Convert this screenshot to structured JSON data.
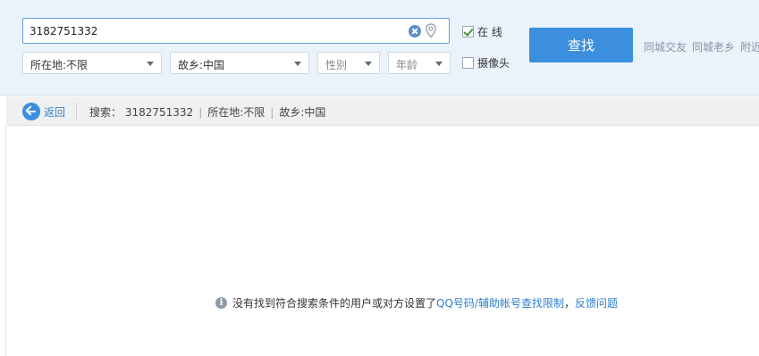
{
  "search": {
    "value": "3182751332",
    "placeholder": ""
  },
  "filters": {
    "location": "所在地:不限",
    "hometown": "故乡:中国",
    "gender": "性别",
    "age": "年龄"
  },
  "options": {
    "online_label": "在 线",
    "online_checked": true,
    "camera_label": "摄像头",
    "camera_checked": false
  },
  "search_button_label": "查找",
  "quick_links": [
    "同城交友",
    "同城老乡",
    "附近"
  ],
  "nav": {
    "back_label": "返回",
    "summary_prefix": "搜索：",
    "summary_query": "3182751332",
    "summary_location": "所在地:不限",
    "summary_hometown": "故乡:中国"
  },
  "notice": {
    "text": "没有找到符合搜索条件的用户或对方设置了",
    "link1": "QQ号码/辅助帐号查找限制",
    "comma": "，",
    "link2": "反馈问题"
  },
  "colors": {
    "accent": "#3c8fdc",
    "link": "#2e7fce",
    "panel_bg": "#eaf2fb"
  }
}
